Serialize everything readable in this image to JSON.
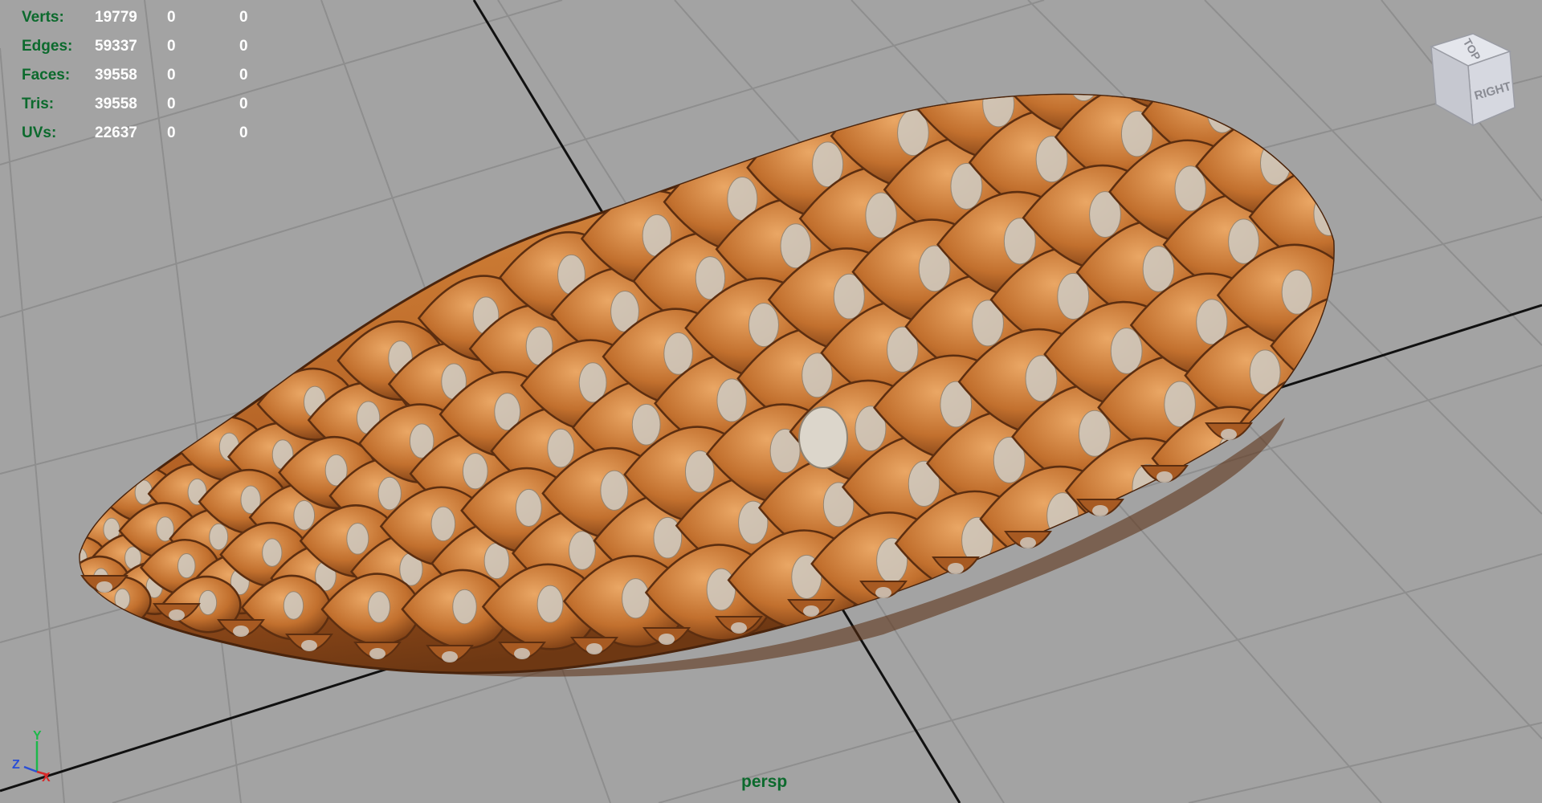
{
  "hud": {
    "rows": [
      {
        "label": "Verts:",
        "total": "19779",
        "selected": "0",
        "components": "0"
      },
      {
        "label": "Edges:",
        "total": "59337",
        "selected": "0",
        "components": "0"
      },
      {
        "label": "Faces:",
        "total": "39558",
        "selected": "0",
        "components": "0"
      },
      {
        "label": "Tris:",
        "total": "39558",
        "selected": "0",
        "components": "0"
      },
      {
        "label": "UVs:",
        "total": "22637",
        "selected": "0",
        "components": "0"
      }
    ]
  },
  "camera": {
    "name": "persp"
  },
  "view_cube": {
    "top_label": "TOP",
    "right_label": "RIGHT"
  },
  "axes": {
    "x": "X",
    "y": "Y",
    "z": "Z"
  },
  "colors": {
    "background": "#a3a3a3",
    "grid_line": "#8e8e8e",
    "axis_line": "#111111",
    "hud_label": "#0c6a2d",
    "hud_value": "#ffffff",
    "cone_base": "#b8652a",
    "cone_light": "#e0934c",
    "cone_dark": "#5c2e10",
    "scale_tip": "#cfc8bd"
  },
  "model": {
    "object": "pine-cone-mesh"
  }
}
